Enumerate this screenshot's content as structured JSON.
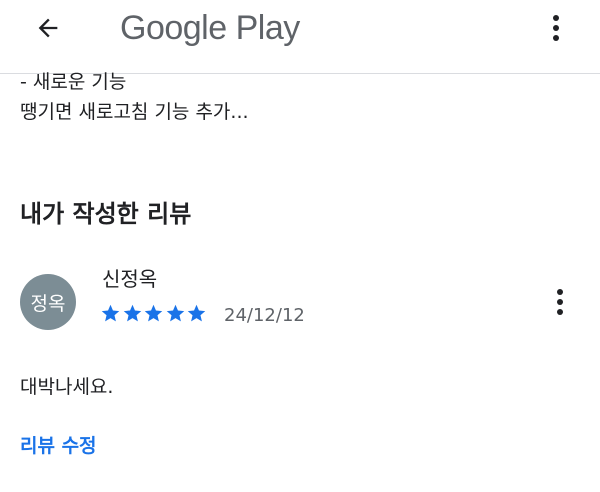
{
  "app_bar": {
    "title": "Google Play",
    "back_icon": "arrow-left-icon",
    "menu_icon": "more-vert-icon"
  },
  "whats_new": {
    "lines": [
      "- 새로운 기능",
      "땡기면 새로고침 기능 추가..."
    ]
  },
  "my_review": {
    "section_title": "내가 작성한 리뷰",
    "avatar_text": "정옥",
    "avatar_color": "#7c8d95",
    "reviewer_name": "신정옥",
    "rating": 5,
    "rating_max": 5,
    "star_color": "#1a73e8",
    "date": "24/12/12",
    "body": "대박나세요.",
    "edit_label": "리뷰 수정",
    "menu_icon": "more-vert-icon"
  }
}
